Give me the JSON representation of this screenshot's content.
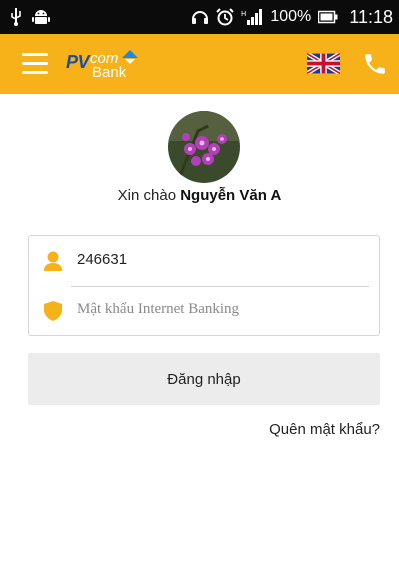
{
  "status_bar": {
    "battery_text": "100%",
    "clock": "11:18",
    "icons": [
      "usb-icon",
      "android-icon",
      "headset-icon",
      "alarm-icon",
      "signal-icon",
      "battery-icon"
    ]
  },
  "app_bar": {
    "background_color": "#f7b21a",
    "logo": {
      "pv": "PV",
      "com": "com",
      "bank": "Bank"
    },
    "icons": [
      "menu-icon",
      "uk-flag-icon",
      "phone-icon"
    ]
  },
  "profile": {
    "greeting_prefix": "Xin chào",
    "user_name": "Nguyễn Văn A"
  },
  "login_form": {
    "username_value": "246631",
    "password_placeholder": "Mật khẩu Internet Banking",
    "login_button_label": "Đăng nhập",
    "forgot_password_link": "Quên mật khẩu?"
  }
}
